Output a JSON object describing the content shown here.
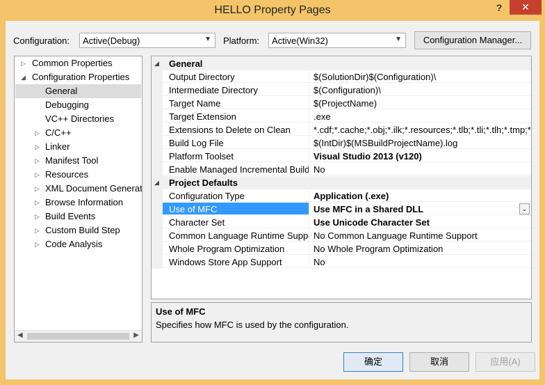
{
  "window": {
    "title": "HELLO Property Pages",
    "help_label": "?",
    "close_label": "✕"
  },
  "toolbar": {
    "configuration_label": "Configuration:",
    "configuration_value": "Active(Debug)",
    "platform_label": "Platform:",
    "platform_value": "Active(Win32)",
    "config_manager_label": "Configuration Manager..."
  },
  "tree": {
    "items": [
      {
        "label": "Common Properties",
        "expander": "collapsed"
      },
      {
        "label": "Configuration Properties",
        "expander": "expanded"
      },
      {
        "label": "General",
        "selected": true
      },
      {
        "label": "Debugging"
      },
      {
        "label": "VC++ Directories"
      },
      {
        "label": "C/C++",
        "expander": "collapsed"
      },
      {
        "label": "Linker",
        "expander": "collapsed"
      },
      {
        "label": "Manifest Tool",
        "expander": "collapsed"
      },
      {
        "label": "Resources",
        "expander": "collapsed"
      },
      {
        "label": "XML Document Generat",
        "expander": "collapsed"
      },
      {
        "label": "Browse Information",
        "expander": "collapsed"
      },
      {
        "label": "Build Events",
        "expander": "collapsed"
      },
      {
        "label": "Custom Build Step",
        "expander": "collapsed"
      },
      {
        "label": "Code Analysis",
        "expander": "collapsed"
      }
    ]
  },
  "grid": {
    "general_category": "General",
    "general_rows": [
      {
        "name": "Output Directory",
        "value": "$(SolutionDir)$(Configuration)\\"
      },
      {
        "name": "Intermediate Directory",
        "value": "$(Configuration)\\"
      },
      {
        "name": "Target Name",
        "value": "$(ProjectName)"
      },
      {
        "name": "Target Extension",
        "value": ".exe"
      },
      {
        "name": "Extensions to Delete on Clean",
        "value": "*.cdf;*.cache;*.obj;*.ilk;*.resources;*.tlb;*.tli;*.tlh;*.tmp;*.r"
      },
      {
        "name": "Build Log File",
        "value": "$(IntDir)$(MSBuildProjectName).log"
      },
      {
        "name": "Platform Toolset",
        "value": "Visual Studio 2013 (v120)",
        "bold": true
      },
      {
        "name": "Enable Managed Incremental Build",
        "value": "No"
      }
    ],
    "defaults_category": "Project Defaults",
    "defaults_rows": [
      {
        "name": "Configuration Type",
        "value": "Application (.exe)",
        "bold": true
      },
      {
        "name": "Use of MFC",
        "value": "Use MFC in a Shared DLL",
        "bold": true,
        "selected": true
      },
      {
        "name": "Character Set",
        "value": "Use Unicode Character Set",
        "bold": true
      },
      {
        "name": "Common Language Runtime Support",
        "value": "No Common Language Runtime Support"
      },
      {
        "name": "Whole Program Optimization",
        "value": "No Whole Program Optimization"
      },
      {
        "name": "Windows Store App Support",
        "value": "No"
      }
    ]
  },
  "description": {
    "title": "Use of MFC",
    "text": "Specifies how MFC is used by the configuration."
  },
  "buttons": {
    "ok": "确定",
    "cancel": "取消",
    "apply": "应用(A)"
  },
  "colors": {
    "frame": "#f4c46a",
    "close": "#c7402e",
    "selection": "#3399ff"
  },
  "icons": {
    "dropdown": "chevron-down-icon",
    "expanded": "triangle-down-icon",
    "collapsed": "triangle-right-icon"
  }
}
